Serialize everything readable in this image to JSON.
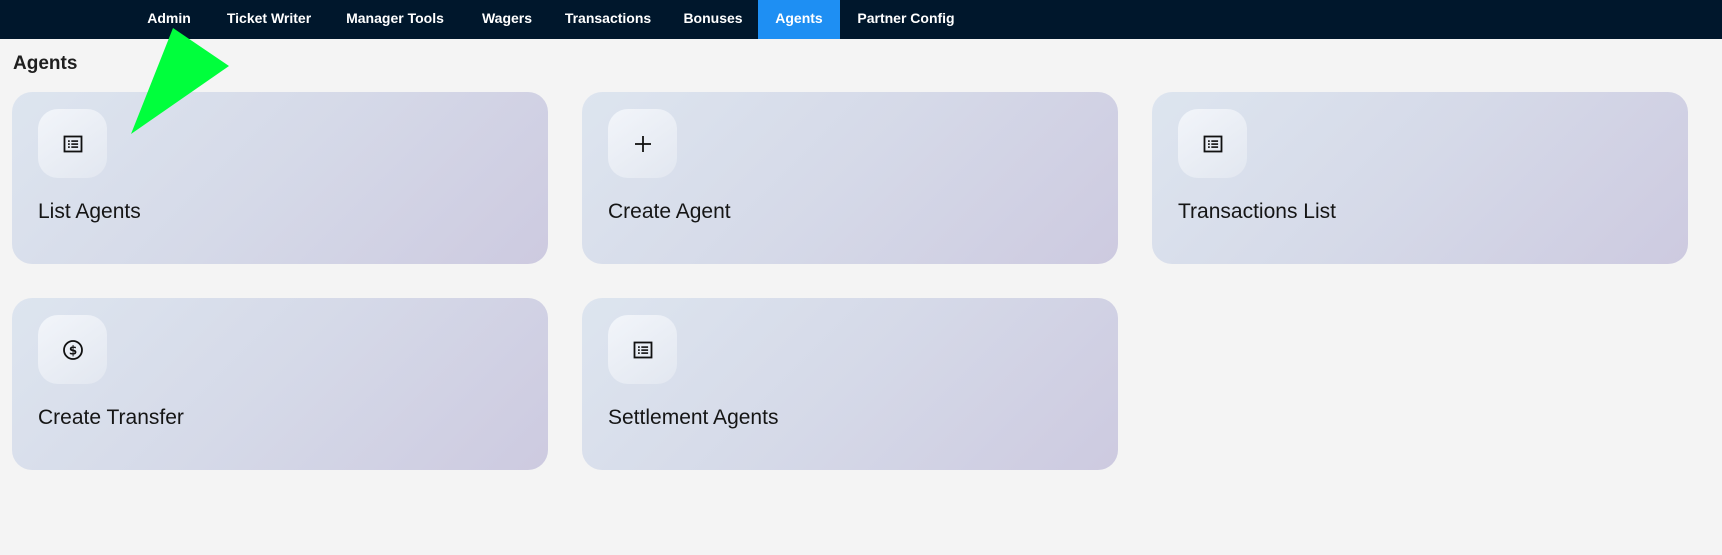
{
  "nav": {
    "items": [
      {
        "label": "Admin",
        "active": false
      },
      {
        "label": "Ticket Writer",
        "active": false
      },
      {
        "label": "Manager Tools",
        "active": false
      },
      {
        "label": "Wagers",
        "active": false
      },
      {
        "label": "Transactions",
        "active": false
      },
      {
        "label": "Bonuses",
        "active": false
      },
      {
        "label": "Agents",
        "active": true
      },
      {
        "label": "Partner Config",
        "active": false
      }
    ],
    "active_color": "#1e8ff3",
    "background_color": "#00172c"
  },
  "page": {
    "title": "Agents"
  },
  "cards": [
    {
      "label": "List Agents",
      "icon": "list-icon"
    },
    {
      "label": "Create Agent",
      "icon": "plus-icon"
    },
    {
      "label": "Transactions List",
      "icon": "list-icon"
    },
    {
      "label": "Create Transfer",
      "icon": "dollar-circle-icon"
    },
    {
      "label": "Settlement Agents",
      "icon": "list-icon"
    }
  ],
  "annotation": {
    "pointer_color": "#00ff3c",
    "pointer_icon": "green-pointer-arrow"
  }
}
